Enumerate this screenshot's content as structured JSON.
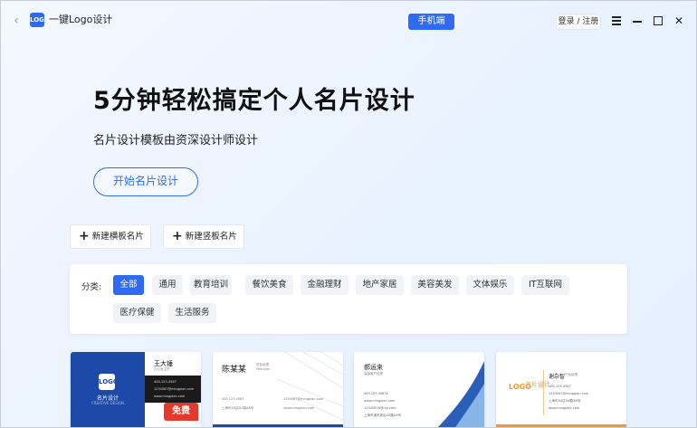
{
  "app": {
    "title": "一键Logo设计",
    "logo_text": "LOGO",
    "back_icon": "chevron-left-icon"
  },
  "header": {
    "mobile_label": "手机端",
    "login_label": "登录 / 注册"
  },
  "hero": {
    "title": "5分钟轻松搞定个人名片设计",
    "subtitle": "名片设计模板由资深设计师设计",
    "cta_label": "开始名片设计"
  },
  "actions": {
    "new_template_label": "新建横板名片",
    "new_blank_label": "新建竖板名片"
  },
  "filter": {
    "label": "分类:",
    "categories": [
      "全部",
      "通用",
      "教育培训",
      "餐饮美食",
      "金融理财",
      "地产家居",
      "美容美发",
      "文体娱乐",
      "IT互联网",
      "医疗保健",
      "生活服务"
    ],
    "active_index": 0
  },
  "cards": [
    {
      "name": "王大锤",
      "role": "办公室主任",
      "brand": "名片设计",
      "brand_en": "CREATIVE DESIGN",
      "lines": [
        "400-123-4567",
        "1234567@mingpian.com",
        "www.mingpian.com"
      ],
      "badge": "免费"
    },
    {
      "name": "陈某某",
      "role_cn": "项目经理",
      "role_en": "Manager",
      "lines": [
        "400 123 4567",
        "1234567@mingpian.com",
        "上海市XX区XX路XX号",
        "www.mingpian.com"
      ]
    },
    {
      "name": "郝运来",
      "role": "高级客户经理",
      "lines": [
        "400 123 45678",
        "www.mingpian.com",
        "12345678@mp.com",
        "上海市浦东新区XX路XX号"
      ]
    },
    {
      "name": "谢杂智",
      "role": "产品经理",
      "title": "名片设计",
      "mark": "LOGO",
      "lines": [
        "400-123-4567",
        "1234567@mingpian.com",
        "上海市XX区XX路XX号",
        "www.mingpian.com"
      ]
    }
  ],
  "colors": {
    "accent": "#2f6bf2",
    "badge_red": "#e23b2e",
    "card_blue": "#1d4aa8",
    "card_orange": "#f29a2e"
  }
}
